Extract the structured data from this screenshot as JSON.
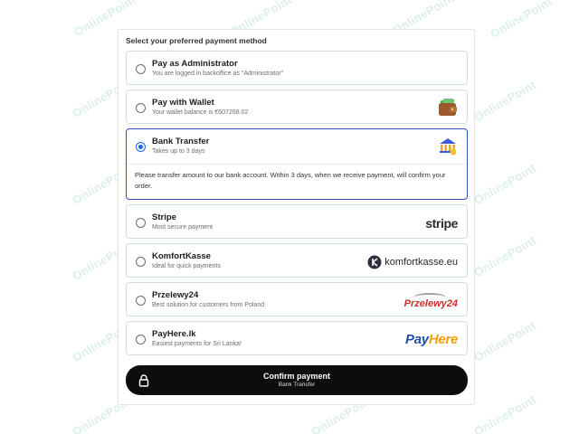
{
  "watermark_text": "OnlinePoint",
  "heading": "Select your preferred payment method",
  "options": [
    {
      "title": "Pay as Administrator",
      "subtitle": "You are logged in backoffice as \"Administrator\"",
      "selected": false,
      "icon": ""
    },
    {
      "title": "Pay with Wallet",
      "subtitle": "Your wallet balance is €607268.02",
      "selected": false,
      "icon": "wallet-icon"
    },
    {
      "title": "Bank Transfer",
      "subtitle": "Takes up to 3 days",
      "selected": true,
      "icon": "bank-icon",
      "description": "Please transfer amount to our bank account. Within 3 days, when we receive payment, will confirm your order."
    },
    {
      "title": "Stripe",
      "subtitle": "Most secure payment",
      "selected": false,
      "icon": "stripe-logo",
      "logo_text": "stripe"
    },
    {
      "title": "KomfortKasse",
      "subtitle": "Ideal for quick payments",
      "selected": false,
      "icon": "komfortkasse-logo",
      "logo_text": "komfortkasse.eu"
    },
    {
      "title": "Przelewy24",
      "subtitle": "Best solution for customers from Poland",
      "selected": false,
      "icon": "przelewy24-logo",
      "logo_text": "Przelewy24"
    },
    {
      "title": "PayHere.lk",
      "subtitle": "Easiest payments for Sri Lanka!",
      "selected": false,
      "icon": "payhere-logo",
      "logo_text_a": "Pay",
      "logo_text_b": "Here"
    }
  ],
  "confirm": {
    "label": "Confirm payment",
    "sublabel": "Bank Transfer",
    "icon": "lock-icon"
  },
  "colors": {
    "accent": "#1e66e0",
    "selected_border": "#2d4fb8",
    "button_bg": "#0d0d0d",
    "option_border": "#cfe3dc"
  }
}
